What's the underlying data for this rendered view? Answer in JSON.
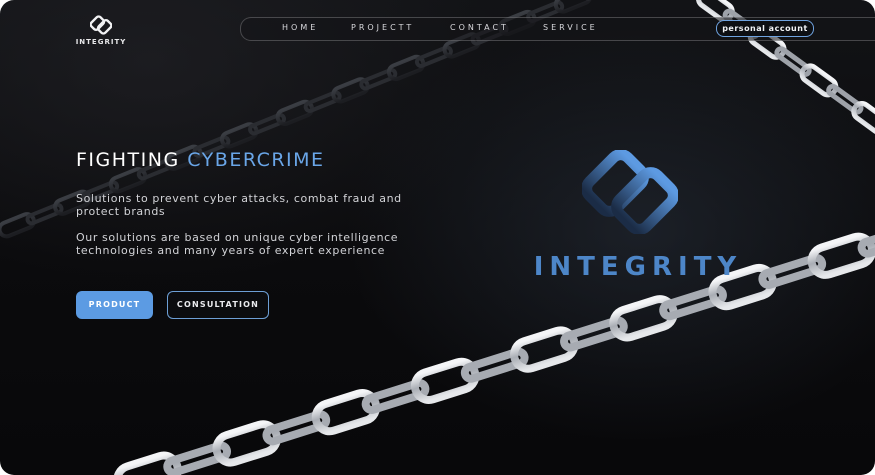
{
  "brand": {
    "name": "INTEGRITY",
    "icon": "integrity-logo-icon"
  },
  "nav": {
    "items": [
      {
        "label": "HOME"
      },
      {
        "label": "PROJECTT"
      },
      {
        "label": "CONTACT"
      },
      {
        "label": "SERVICE"
      }
    ],
    "account_label": "personal account"
  },
  "hero": {
    "title_main": "FIGHTING",
    "title_accent": "CYBERCRIME",
    "paragraph_1": "Solutions to prevent cyber attacks, combat fraud and protect brands",
    "paragraph_2": "Our solutions are based on unique cyber intelligence technologies and many years of expert experience",
    "buttons": {
      "product": "PRODUCT",
      "consultation": "CONSULTATION"
    }
  },
  "logo": {
    "word": "INTEGRITY",
    "icon": "integrity-large-logo-icon"
  },
  "colors": {
    "accent": "#5c9be3",
    "title_accent": "#6aa6e8",
    "background": "#0b0b0d",
    "chain": "#c9ccd1"
  }
}
